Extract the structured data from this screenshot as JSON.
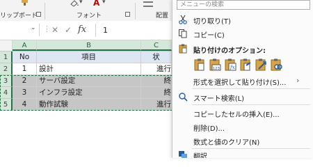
{
  "ribbon": {
    "clipboard_label": "リップボード",
    "font_label": "フォント",
    "align_label": "配置"
  },
  "formula_bar": {
    "fx_label": "fx",
    "value": "1"
  },
  "columns": [
    "A",
    "B",
    "C"
  ],
  "rows": [
    {
      "num": "1",
      "a": "No",
      "b": "項目",
      "c": "状"
    },
    {
      "num": "2",
      "a": "1",
      "b": "設計",
      "c": "進行"
    },
    {
      "num": "3",
      "a": "2",
      "b": "サーバ設定",
      "c": "終"
    },
    {
      "num": "4",
      "a": "3",
      "b": "インフラ設定",
      "c": "終"
    },
    {
      "num": "5",
      "a": "4",
      "b": "動作試験",
      "c": "進行"
    }
  ],
  "context_menu": {
    "search_placeholder": "メニューの検索",
    "cut": "切り取り(T)",
    "copy": "コピー(C)",
    "paste_options": "貼り付けのオプション:",
    "paste_special": "形式を選択して貼り付け(S)...",
    "smart_lookup": "スマート検索(L)",
    "insert_copied": "コピーしたセルの挿入(E)...",
    "delete": "削除(D)...",
    "clear_contents": "数式と値のクリア(N)",
    "translate": "翻訳"
  },
  "colors": {
    "accent": "#217346",
    "header_fill": "#dde6f2",
    "selection_fill": "#c6c6c6"
  }
}
